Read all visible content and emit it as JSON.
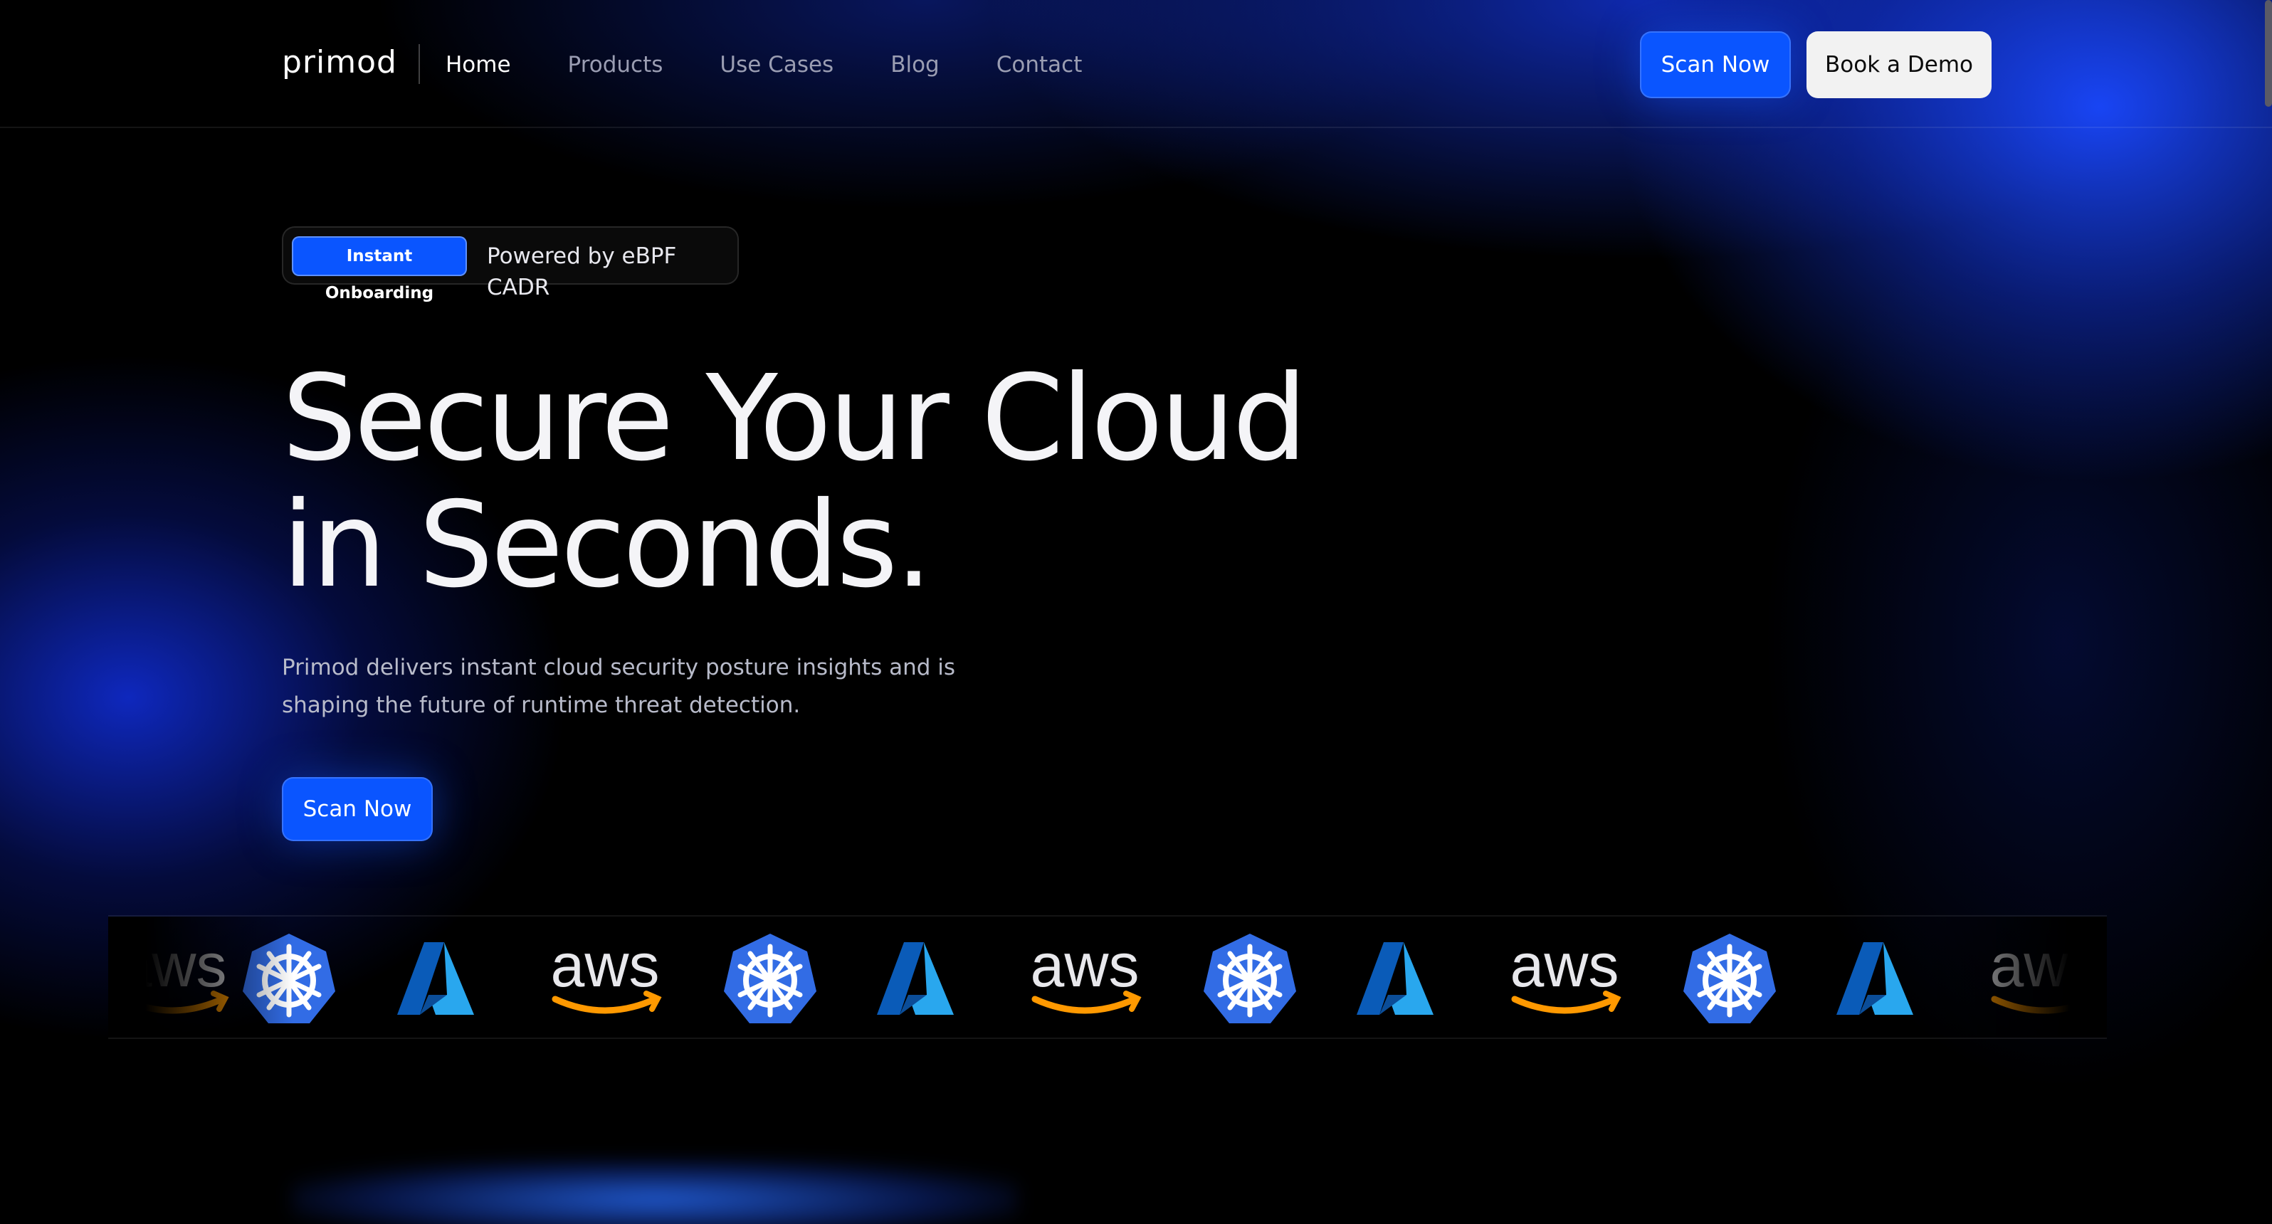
{
  "brand": {
    "name": "primod"
  },
  "nav": {
    "items": [
      "Home",
      "Products",
      "Use Cases",
      "Blog",
      "Contact"
    ],
    "active": "Home",
    "scan_label": "Scan Now",
    "demo_label": "Book a Demo"
  },
  "badge": {
    "pill": "Instant Onboarding",
    "text": "Powered by eBPF CADR"
  },
  "hero": {
    "title_line1": "Secure Your Cloud",
    "title_line2": "in Seconds.",
    "description_line1": "Primod delivers instant cloud security posture insights and is",
    "description_line2": "shaping the future of runtime threat detection.",
    "cta_label": "Scan Now"
  },
  "logos": {
    "aws_text": "aws",
    "sequence": [
      "aws-logo",
      "kubernetes-logo",
      "azure-logo",
      "aws-logo",
      "kubernetes-logo",
      "azure-logo",
      "aws-logo",
      "kubernetes-logo",
      "azure-logo",
      "aws-logo",
      "kubernetes-logo",
      "azure-logo",
      "aws-logo"
    ]
  },
  "colors": {
    "accent": "#0a55ff",
    "kubernetes": "#326ce5",
    "azure": "#0078d4",
    "aws_smile": "#ff9900"
  }
}
